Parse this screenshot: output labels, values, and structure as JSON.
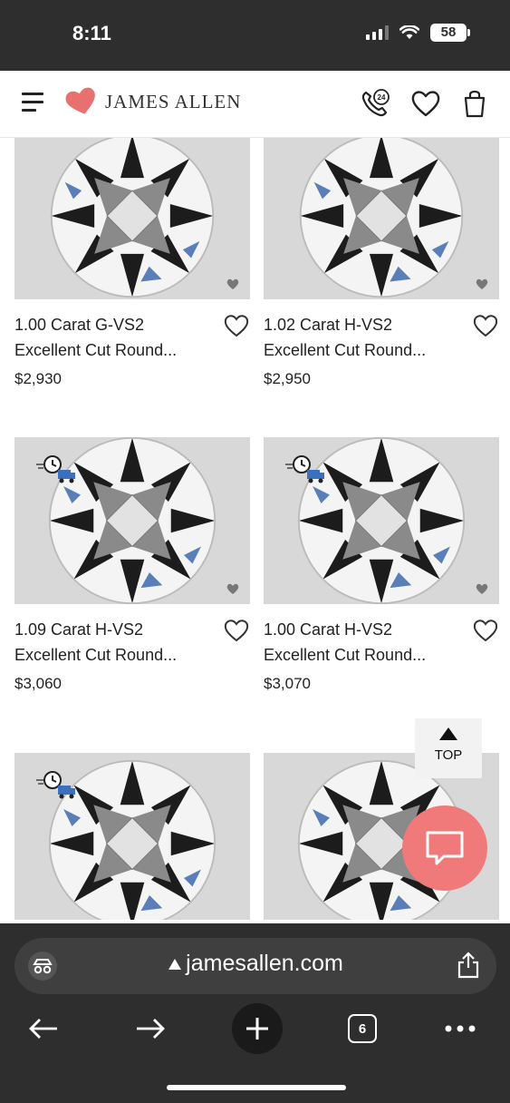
{
  "status_bar": {
    "time": "8:11",
    "battery": "58"
  },
  "header": {
    "brand": "JAMES ALLEN",
    "phone_badge": "24",
    "icons": [
      "menu-icon",
      "heart-logo-icon",
      "phone-24-icon",
      "wishlist-heart-icon",
      "shopping-bag-icon"
    ]
  },
  "products": [
    {
      "title_line1": "1.00 Carat G-VS2",
      "title_line2": "Excellent Cut Round...",
      "price": "$2,930",
      "delivery_badge": false
    },
    {
      "title_line1": "1.02 Carat H-VS2",
      "title_line2": "Excellent Cut Round...",
      "price": "$2,950",
      "delivery_badge": false
    },
    {
      "title_line1": "1.09 Carat H-VS2",
      "title_line2": "Excellent Cut Round...",
      "price": "$3,060",
      "delivery_badge": true
    },
    {
      "title_line1": "1.00 Carat H-VS2",
      "title_line2": "Excellent Cut Round...",
      "price": "$3,070",
      "delivery_badge": true
    },
    {
      "delivery_badge": true
    },
    {
      "delivery_badge": false
    }
  ],
  "top_button": {
    "label": "TOP"
  },
  "browser": {
    "url": "jamesallen.com",
    "tab_count": "6"
  },
  "colors": {
    "brand_heart": "#e8706f",
    "chat": "#f07a7a",
    "chrome": "#2e2e2e",
    "image_bg": "#d8d8d8"
  }
}
